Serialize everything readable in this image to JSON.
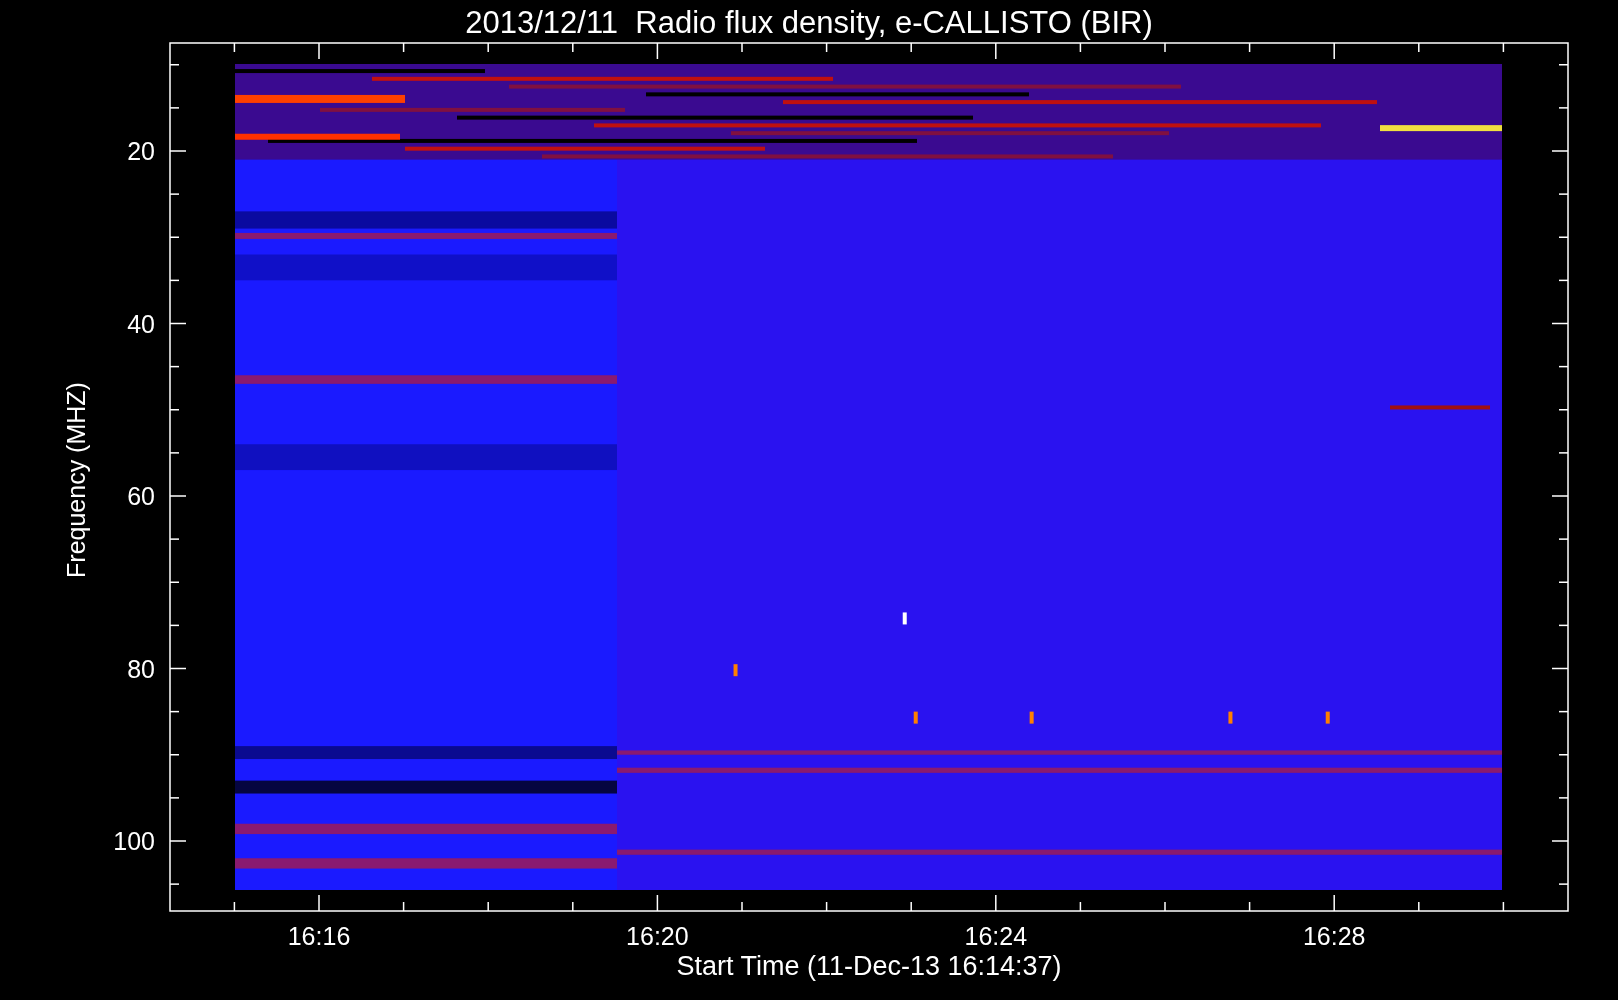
{
  "title": "2013/12/11  Radio flux density, e-CALLISTO (BIR)",
  "y_axis": {
    "label": "Frequency (MHZ)",
    "ticks": [
      "20",
      "40",
      "60",
      "80",
      "100"
    ]
  },
  "x_axis": {
    "label": "Start Time (11-Dec-13 16:14:37)",
    "ticks": [
      "16:16",
      "16:20",
      "16:24",
      "16:28"
    ]
  }
}
